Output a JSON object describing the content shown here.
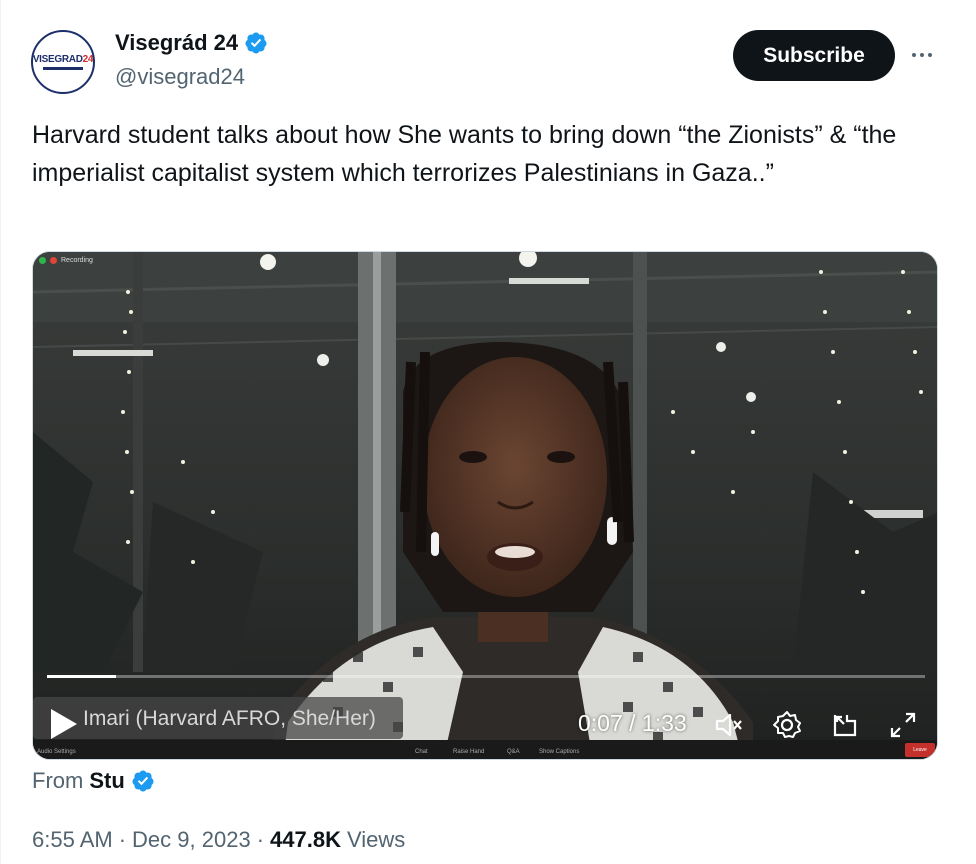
{
  "author": {
    "display_name": "Visegrád 24",
    "handle": "@visegrad24",
    "avatar_text": "VISEGRAD",
    "avatar_number": "24",
    "verified": true
  },
  "actions": {
    "subscribe_label": "Subscribe"
  },
  "tweet": {
    "text": "Harvard student talks about how She wants to bring down “the Zionists” & “the imperialist capitalist system which terrorizes Palestinians in Gaza..”"
  },
  "video": {
    "recording_label": "Recording",
    "participant_name": "Imari (Harvard AFRO, She/Her)",
    "time_display": "0:07 / 1:33",
    "progress_fraction": 0.079,
    "toolbar": {
      "audio_settings": "Audio Settings",
      "chat": "Chat",
      "raise_hand": "Raise Hand",
      "qa": "Q&A",
      "captions": "Show Captions",
      "leave": "Leave"
    }
  },
  "attribution": {
    "prefix": "From",
    "user": "Stu"
  },
  "meta": {
    "time": "6:55 AM",
    "separator": "·",
    "date": "Dec 9, 2023",
    "views_count": "447.8K",
    "views_label": "Views"
  },
  "colors": {
    "verified_blue": "#1d9bf0",
    "text_primary": "#0f1419",
    "text_secondary": "#536471",
    "subscribe_bg": "#0f1419"
  }
}
